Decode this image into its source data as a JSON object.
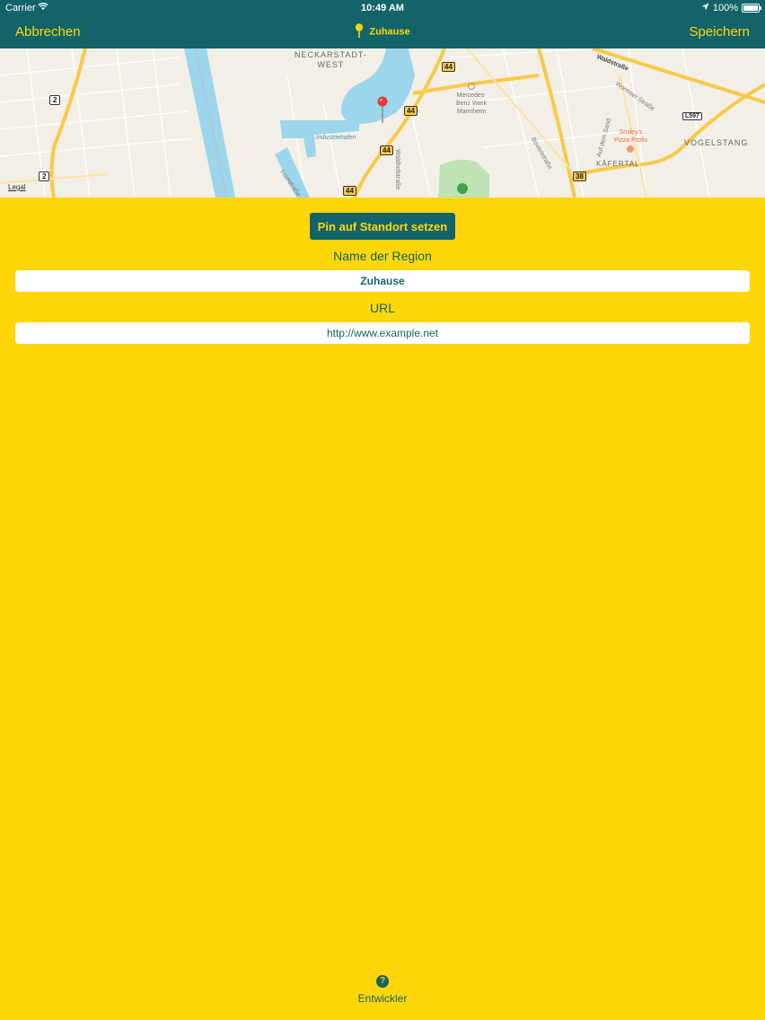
{
  "status_bar": {
    "carrier": "Carrier",
    "time": "10:49 AM",
    "battery": "100%"
  },
  "nav": {
    "cancel_label": "Abbrechen",
    "title": "Zuhause",
    "save_label": "Speichern"
  },
  "map": {
    "legal": "Legal",
    "places": {
      "neckarstadt_line1": "NECKARSTADT-",
      "neckarstadt_line2": "WEST",
      "mercedes_line1": "Mercedes-",
      "mercedes_line2": "Benz Werk",
      "mercedes_line3": "Mannheim",
      "smileys_line1": "Smiley's",
      "smileys_line2": "Pizza Profis",
      "vogelstang": "VOGELSTANG",
      "kafertal": "KÄFERTAL",
      "industriehafen": "Industriehafen"
    },
    "streets": {
      "waldstrasse": "Waldstraße",
      "wormser": "Wormser Straße",
      "auf_dem_sand": "Auf dem Sand",
      "boveristrasse": "Boveristraße",
      "waldhofstrasse": "Waldhofstraße",
      "inselstrasse": "Inselstraße"
    },
    "route_badges": {
      "b44_a": "44",
      "b44_b": "44",
      "b44_c": "44",
      "b44_d": "44",
      "b38": "38",
      "l597": "L597",
      "r2_a": "2",
      "r2_b": "2"
    }
  },
  "form": {
    "pin_button_label": "Pin auf Standort setzen",
    "region_label": "Name der Region",
    "region_value": "Zuhause",
    "url_label": "URL",
    "url_value": "http://www.example.net"
  },
  "footer": {
    "help_glyph": "?",
    "developer_label": "Entwickler"
  },
  "colors": {
    "background": "#FFD60A",
    "primary": "#136469",
    "pin": "#E53935"
  }
}
